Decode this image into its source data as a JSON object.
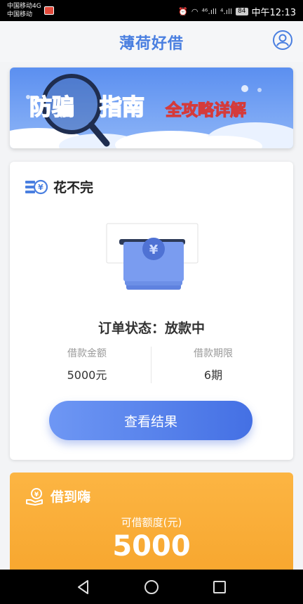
{
  "status_bar": {
    "carrier_line1": "中国移动4G",
    "carrier_line2": "中国移动",
    "signal1": "⁴⁶.ıll",
    "signal2": "⁴.ıll",
    "battery": "84",
    "time": "中午12:13"
  },
  "header": {
    "title": "薄荷好借"
  },
  "banner": {
    "text1": "防骗",
    "text2": "指南",
    "text3": "全攻略详解"
  },
  "card1": {
    "title": "花不完",
    "order_status": "订单状态：放款中",
    "amount_label": "借款金额",
    "amount_value": "5000元",
    "term_label": "借款期限",
    "term_value": "6期",
    "button_label": "查看结果"
  },
  "card2": {
    "title": "借到嗨",
    "limit_label": "可借额度(元)",
    "limit_value": "5000"
  },
  "colors": {
    "brand_blue": "#4a7fe0",
    "button_gradient_start": "#6e97f4",
    "button_gradient_end": "#4470e4",
    "orange": "#f7a62e"
  },
  "icons": {
    "profile": "user-icon",
    "card1": "money-stack-icon",
    "card2": "hand-coin-icon",
    "nav_back": "back-icon",
    "nav_home": "home-icon",
    "nav_recent": "recent-apps-icon"
  }
}
